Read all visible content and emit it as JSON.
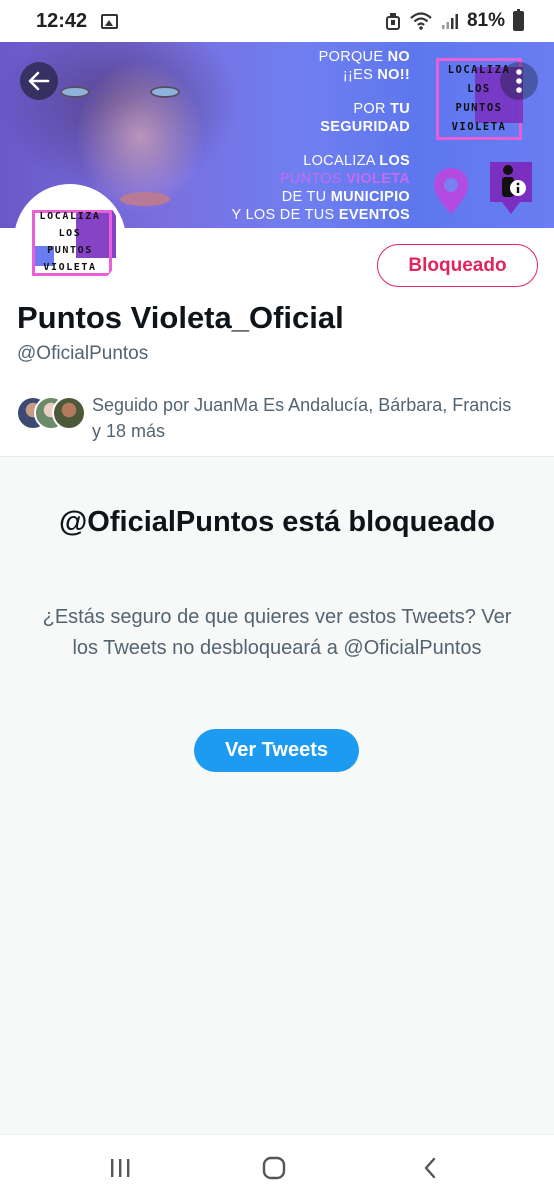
{
  "status_bar": {
    "time": "12:42",
    "battery": "81%"
  },
  "banner": {
    "lines": [
      {
        "a": "PORQUE ",
        "b": "NO"
      },
      {
        "a": "¡¡ES ",
        "b": "NO!!"
      },
      {
        "a": "POR ",
        "b": "TU"
      },
      {
        "a": "",
        "b": "SEGURIDAD"
      },
      {
        "a": "LOCALIZA ",
        "b": "LOS"
      },
      {
        "a": "PUNTOS ",
        "b": "VIOLETA"
      },
      {
        "a": "DE TU ",
        "b": "MUNICIPIO"
      },
      {
        "a": "Y LOS DE TUS ",
        "b": "EVENTOS"
      }
    ],
    "logo": [
      "LOCALIZA",
      "LOS",
      "PUNTOS",
      "VIOLETA"
    ]
  },
  "profile": {
    "avatar_logo": [
      "LOCALIZA",
      "LOS",
      "PUNTOS",
      "VIOLETA"
    ],
    "blocked_button": "Bloqueado",
    "display_name": "Puntos Violeta_Oficial",
    "handle": "@OficialPuntos",
    "followed_by": "Seguido por JuanMa Es Andalucía, Bárbara, Francis y 18 más"
  },
  "blocked": {
    "title": "@OficialPuntos está bloqueado",
    "description": "¿Estás seguro de que quieres ver estos Tweets? Ver los Tweets no desbloqueará a @OficialPuntos",
    "view_button": "Ver Tweets"
  },
  "colors": {
    "accent": "#1d9bf0",
    "blocked": "#e0245e",
    "violet": "#7a2fc0",
    "banner": "#6f7ff0"
  },
  "icons": {
    "back": "arrow-left-icon",
    "more": "more-vertical-icon",
    "nav_recent": "recent-apps-icon",
    "nav_home": "home-icon",
    "nav_back": "back-icon"
  }
}
